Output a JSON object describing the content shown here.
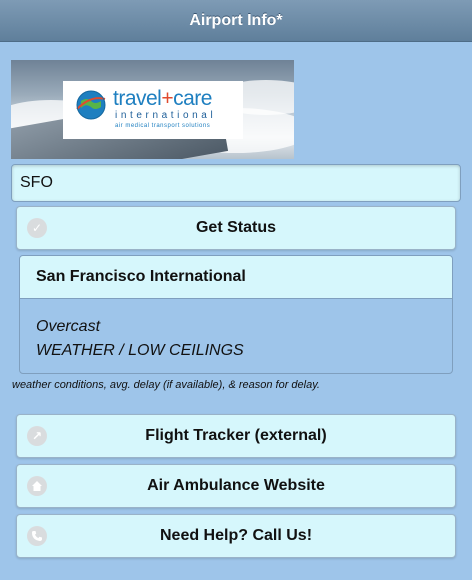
{
  "header": {
    "title": "Airport Info*"
  },
  "banner": {
    "brand_travel": "travel",
    "brand_plus": "+",
    "brand_care": "care",
    "brand_sub": "international",
    "brand_tagline": "air medical transport solutions"
  },
  "airport_input": {
    "value": "SFO"
  },
  "get_status": {
    "label": "Get Status",
    "icon": "check-icon"
  },
  "status_card": {
    "airport_name": "San Francisco International",
    "weather": "Overcast",
    "delay_reason": "WEATHER / LOW CEILINGS"
  },
  "note": "weather conditions, avg. delay (if available), & reason for delay.",
  "links": [
    {
      "label": "Flight Tracker (external)",
      "icon": "external-arrow-icon"
    },
    {
      "label": "Air Ambulance Website",
      "icon": "home-icon"
    },
    {
      "label": "Need Help? Call Us!",
      "icon": "phone-icon"
    }
  ],
  "colors": {
    "background": "#9ec5ea",
    "header": "#6f8ea9",
    "button": "#d6f7fc",
    "brand_blue": "#1e7fc0",
    "brand_red": "#e04a2e"
  }
}
